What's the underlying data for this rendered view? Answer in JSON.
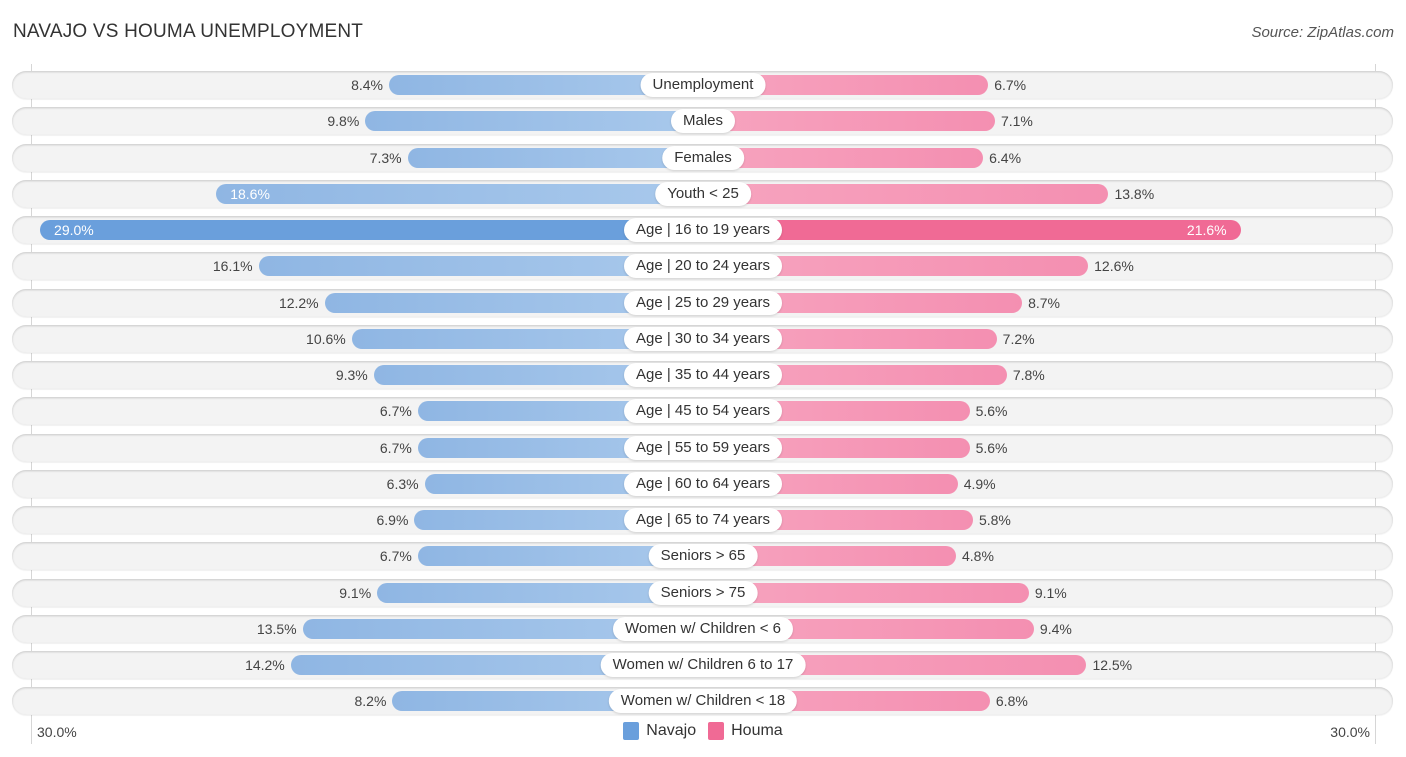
{
  "title": "NAVAJO VS HOUMA UNEMPLOYMENT",
  "source": "Source: ZipAtlas.com",
  "colors": {
    "navajo": "#6a9fdc",
    "houma": "#f06a95"
  },
  "legend": [
    {
      "name": "Navajo",
      "color": "#6a9fdc"
    },
    {
      "name": "Houma",
      "color": "#f06a95"
    }
  ],
  "axis": {
    "left_label": "30.0%",
    "right_label": "30.0%"
  },
  "chart_data": {
    "type": "bar",
    "orientation": "horizontal-diverging",
    "title": "NAVAJO VS HOUMA UNEMPLOYMENT",
    "xlim": [
      0,
      30
    ],
    "tick_labels": [
      "30.0%",
      "30.0%"
    ],
    "legend_position": "bottom-center",
    "categories": [
      "Unemployment",
      "Males",
      "Females",
      "Youth < 25",
      "Age | 16 to 19 years",
      "Age | 20 to 24 years",
      "Age | 25 to 29 years",
      "Age | 30 to 34 years",
      "Age | 35 to 44 years",
      "Age | 45 to 54 years",
      "Age | 55 to 59 years",
      "Age | 60 to 64 years",
      "Age | 65 to 74 years",
      "Seniors > 65",
      "Seniors > 75",
      "Women w/ Children < 6",
      "Women w/ Children 6 to 17",
      "Women w/ Children < 18"
    ],
    "series": [
      {
        "name": "Navajo",
        "side": "left",
        "values": [
          8.4,
          9.8,
          7.3,
          18.6,
          29.0,
          16.1,
          12.2,
          10.6,
          9.3,
          6.7,
          6.7,
          6.3,
          6.9,
          6.7,
          9.1,
          13.5,
          14.2,
          8.2
        ],
        "labels": [
          "8.4%",
          "9.8%",
          "7.3%",
          "18.6%",
          "29.0%",
          "16.1%",
          "12.2%",
          "10.6%",
          "9.3%",
          "6.7%",
          "6.7%",
          "6.3%",
          "6.9%",
          "6.7%",
          "9.1%",
          "13.5%",
          "14.2%",
          "8.2%"
        ]
      },
      {
        "name": "Houma",
        "side": "right",
        "values": [
          6.7,
          7.1,
          6.4,
          13.8,
          21.6,
          12.6,
          8.7,
          7.2,
          7.8,
          5.6,
          5.6,
          4.9,
          5.8,
          4.8,
          9.1,
          9.4,
          12.5,
          6.8
        ],
        "labels": [
          "6.7%",
          "7.1%",
          "6.4%",
          "13.8%",
          "21.6%",
          "12.6%",
          "8.7%",
          "7.2%",
          "7.8%",
          "5.6%",
          "5.6%",
          "4.9%",
          "5.8%",
          "4.8%",
          "9.1%",
          "9.4%",
          "12.5%",
          "6.8%"
        ]
      }
    ]
  }
}
